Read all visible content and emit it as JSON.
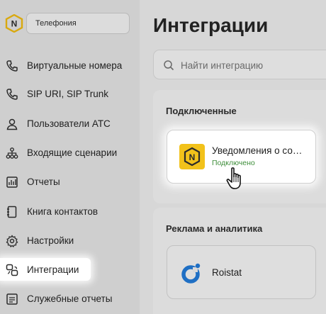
{
  "sidebar": {
    "logo_icon": "brand-n-hexagon-icon",
    "env_select": "Телефония",
    "items": [
      {
        "label": "Виртуальные номера",
        "icon": "phone-icon"
      },
      {
        "label": "SIP URI, SIP Trunk",
        "icon": "phone-icon"
      },
      {
        "label": "Пользователи АТС",
        "icon": "user-icon"
      },
      {
        "label": "Входящие сценарии",
        "icon": "hierarchy-icon"
      },
      {
        "label": "Отчеты",
        "icon": "report-chart-icon"
      },
      {
        "label": "Книга контактов",
        "icon": "contact-book-icon"
      },
      {
        "label": "Настройки",
        "icon": "gear-icon"
      },
      {
        "label": "Интеграции",
        "icon": "integrations-icon",
        "active": true
      },
      {
        "label": "Служебные отчеты",
        "icon": "list-report-icon"
      }
    ]
  },
  "main": {
    "title": "Интеграции",
    "search": {
      "placeholder": "Найти интеграцию",
      "icon": "search-icon"
    },
    "connected": {
      "title": "Подключенные",
      "items": [
        {
          "name": "Уведомления о событиях",
          "status": "Подключено",
          "icon": "brand-n-hexagon-icon"
        }
      ]
    },
    "ads": {
      "title": "Реклама и аналитика",
      "items": [
        {
          "name": "Roistat",
          "icon": "roistat-icon"
        }
      ]
    }
  },
  "colors": {
    "brand_yellow": "#f2c21b",
    "status_green": "#3e8e3a",
    "roistat_blue": "#1f6fc4"
  },
  "cursor": {
    "icon": "hand-pointer-icon"
  }
}
